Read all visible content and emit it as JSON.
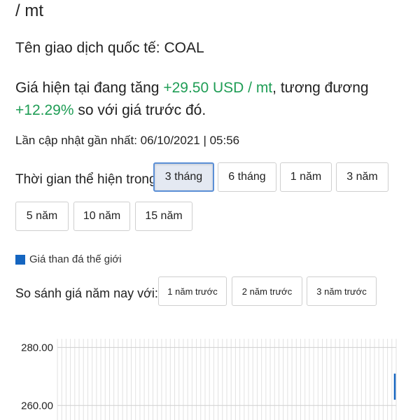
{
  "header": {
    "unit_fragment": "/ mt"
  },
  "ticker_line": "Tên giao dịch quốc tế: COAL",
  "price_change": {
    "prefix": "Giá hiện tại đang tăng ",
    "change_value": "+29.50 USD / mt",
    "middle": ", tương đương",
    "change_percent": "+12.29%",
    "suffix": " so với giá trước đó."
  },
  "last_updated": "Lần cập nhật gần nhất: 06/10/2021 | 05:56",
  "time_range": {
    "label": "Thời gian thể hiện trong:",
    "options": [
      "3 tháng",
      "6 tháng",
      "1 năm",
      "3 năm",
      "5 năm",
      "10 năm",
      "15 năm"
    ],
    "selected": "3 tháng"
  },
  "legend": {
    "label": "Giá than đá thế giới",
    "color": "#1565c0"
  },
  "compare": {
    "label": "So sánh giá năm nay với:",
    "options": [
      "1 năm trước",
      "2 năm trước",
      "3 năm trước"
    ]
  },
  "chart_data": {
    "type": "line",
    "series": [
      {
        "name": "Giá than đá thế giới",
        "color": "#1565c0",
        "values": [
          262,
          271
        ]
      }
    ],
    "y_tick_labels": [
      "280.00",
      "260.00"
    ],
    "ylim": [
      255,
      283
    ],
    "grid": true
  }
}
